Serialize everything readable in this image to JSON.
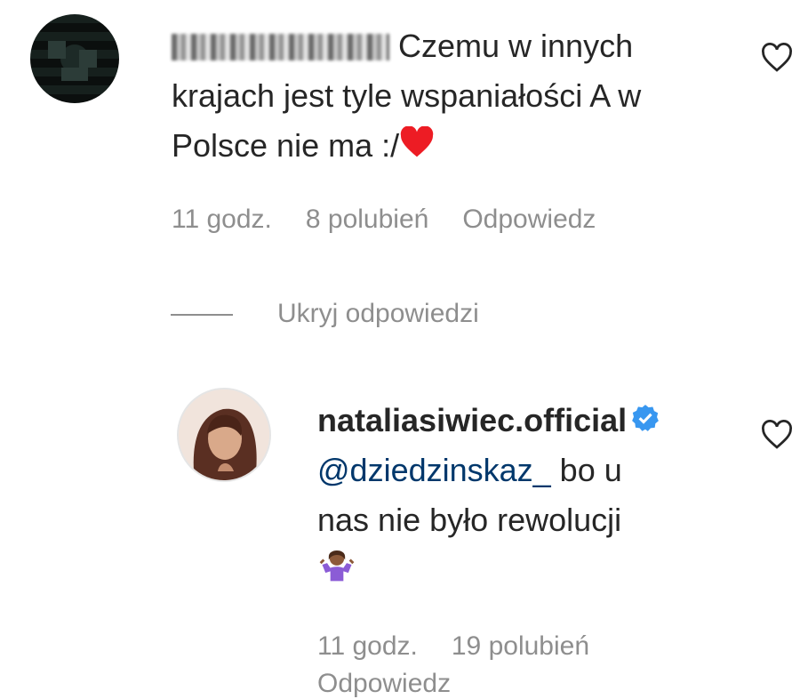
{
  "comment": {
    "username_blurred": "d••••••_",
    "text": "Czemu w innych krajach jest tyle wspaniałości A w Polsce nie ma :/",
    "emoji": "red-heart",
    "time": "11 godz.",
    "likes": "8 polubień",
    "reply_label": "Odpowiedz"
  },
  "toggle_replies": "Ukryj odpowiedzi",
  "reply": {
    "username": "nataliasiwiec.official",
    "mention": "@dziedzinskaz_",
    "text_part1": " bo u",
    "text_part2": "nas nie było rewolucji",
    "emoji": "person-shrugging",
    "time": "11 godz.",
    "likes": "19 polubień",
    "reply_label": "Odpowiedz"
  },
  "colors": {
    "text": "#262626",
    "secondary": "#8e8e8e",
    "mention": "#00376b",
    "verified": "#3897f0",
    "heart": "#ed1c24"
  }
}
